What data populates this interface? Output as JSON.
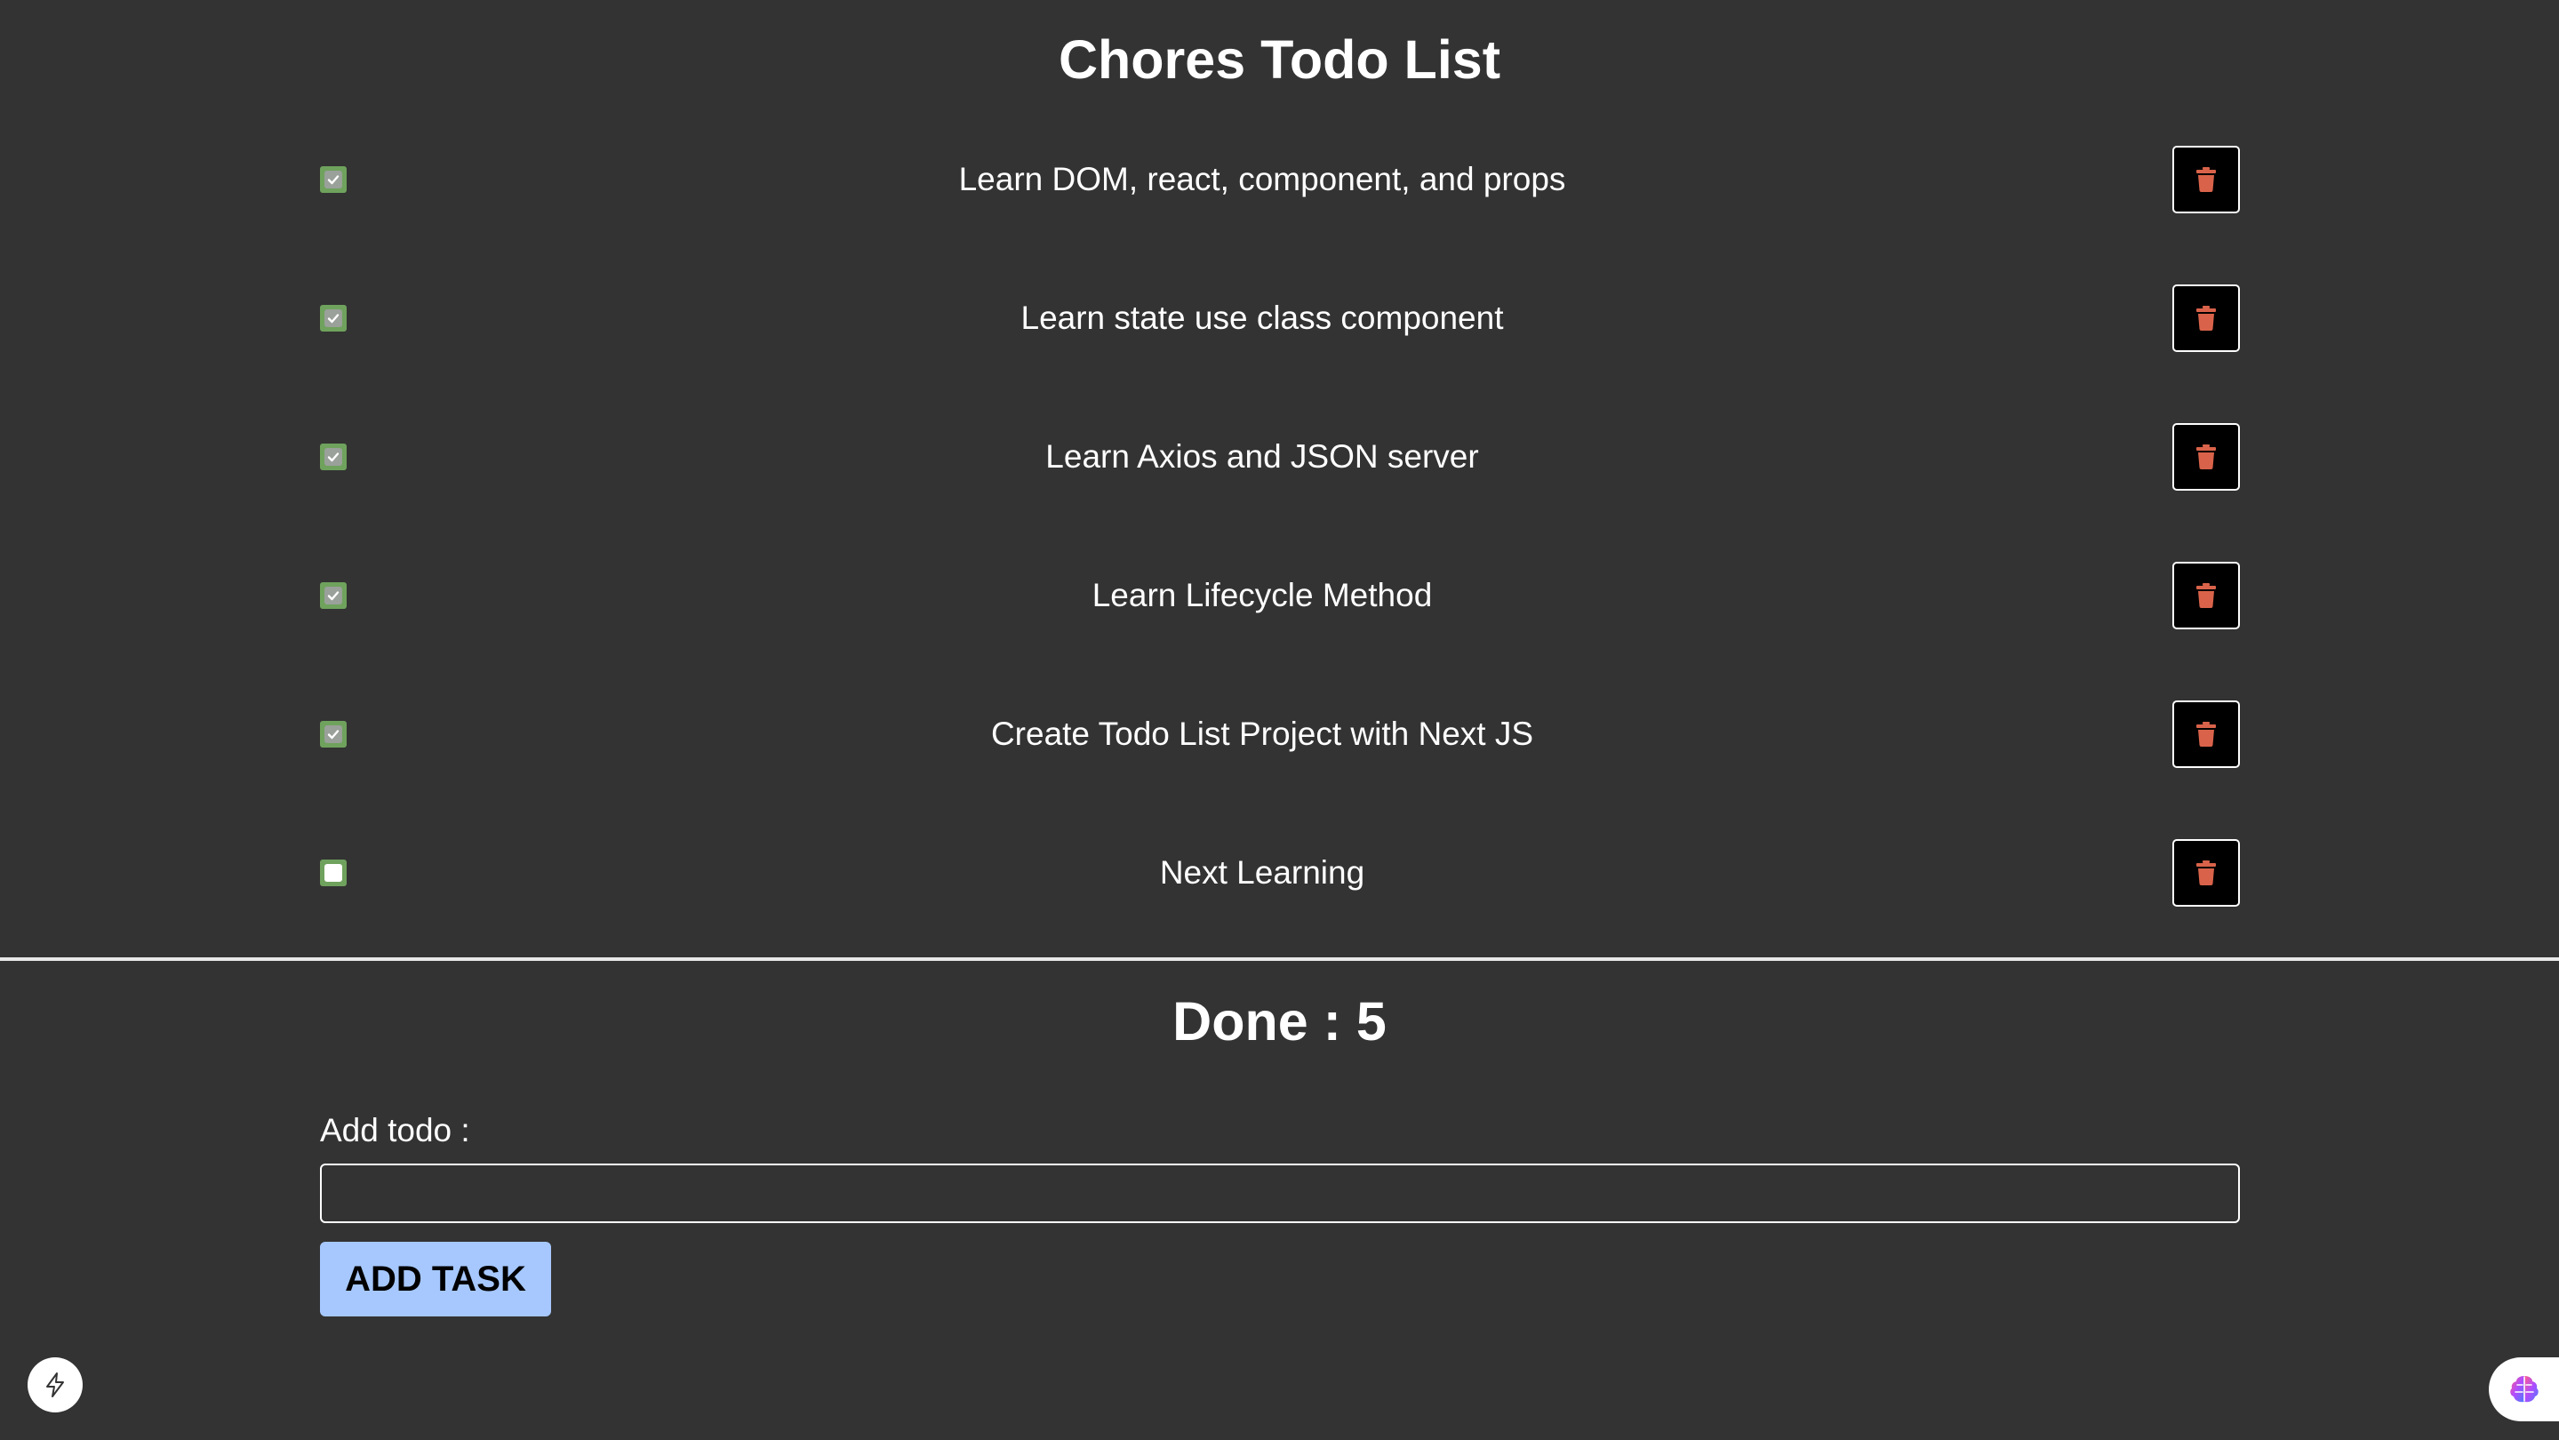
{
  "title": "Chores Todo List",
  "todos": [
    {
      "text": "Learn DOM, react, component, and props",
      "done": true
    },
    {
      "text": "Learn state use class component",
      "done": true
    },
    {
      "text": "Learn Axios and JSON server",
      "done": true
    },
    {
      "text": "Learn Lifecycle Method",
      "done": true
    },
    {
      "text": "Create Todo List Project with Next JS",
      "done": true
    },
    {
      "text": "Next Learning",
      "done": false
    }
  ],
  "done_text": "Done : 5",
  "add_form": {
    "label": "Add todo :",
    "input_value": "",
    "button_label": "ADD TASK"
  },
  "icons": {
    "checkbox": "checkmark-icon",
    "delete": "trash-icon",
    "bottom_left": "lightning-bolt-icon",
    "bottom_right": "brain-icon"
  },
  "colors": {
    "background": "#333333",
    "checkbox_accent": "#6fa25d",
    "trash": "#d9634a",
    "add_button": "#a6c8ff"
  }
}
